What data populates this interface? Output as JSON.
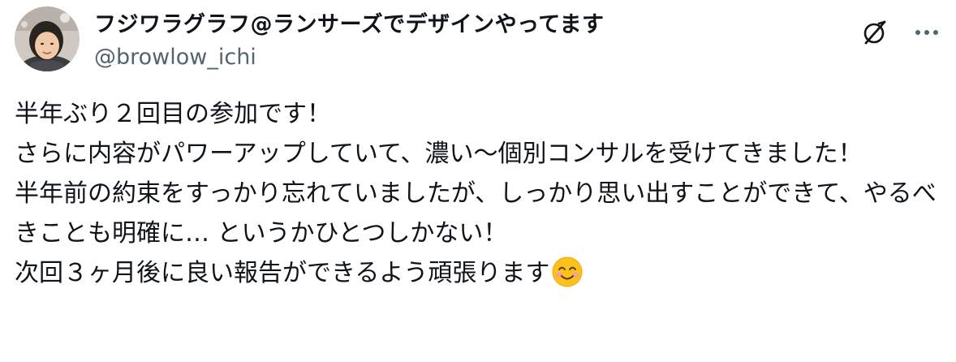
{
  "author": {
    "display_name": "フジワラグラフ@ランサーズでデザインやってます",
    "handle": "@browlow_ichi",
    "avatar_icon": "profile-photo"
  },
  "actions": {
    "grok_icon": "grok-slash-icon",
    "more_icon": "more-dots-icon"
  },
  "tweet": {
    "text": "半年ぶり２回目の参加です！\nさらに内容がパワーアップしていて、濃い〜個別コンサルを受けてきました！\n半年前の約束をすっかり忘れていましたが、しっかり思い出すことができて、やるべきことも明確に… というかひとつしかない！\n次回３ヶ月後に良い報告ができるよう頑張ります",
    "emoji": "smiling-face-with-smiling-eyes"
  },
  "colors": {
    "text_primary": "#0f1419",
    "text_secondary": "#536471",
    "background": "#ffffff"
  }
}
